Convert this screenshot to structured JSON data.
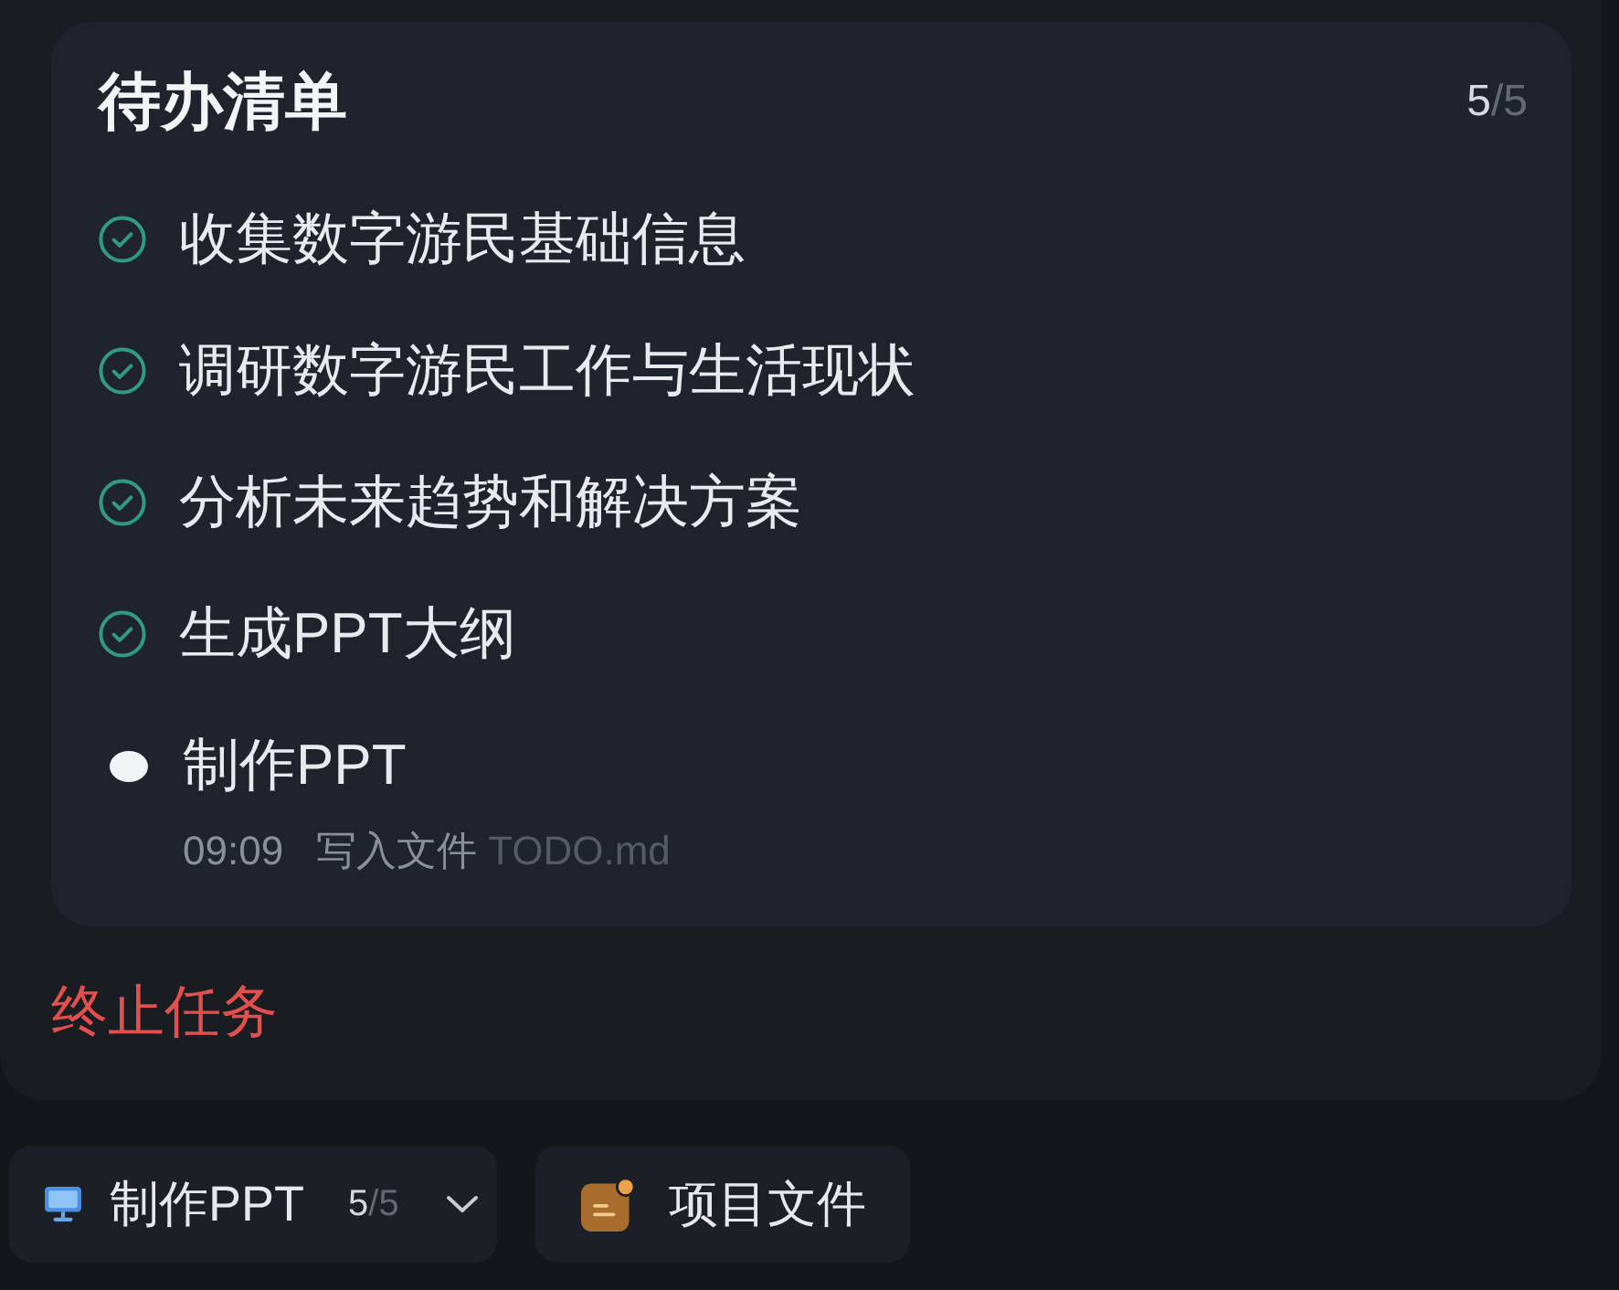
{
  "todo": {
    "title": "待办清单",
    "progress": {
      "done": "5",
      "total": "/5"
    },
    "items": [
      {
        "text": "收集数字游民基础信息",
        "done": true
      },
      {
        "text": "调研数字游民工作与生活现状",
        "done": true
      },
      {
        "text": "分析未来趋势和解决方案",
        "done": true
      },
      {
        "text": "生成PPT大纲",
        "done": true
      },
      {
        "text": "制作PPT",
        "done": false,
        "detail": {
          "time": "09:09",
          "action": "写入文件",
          "file": "TODO.md"
        }
      }
    ]
  },
  "stop_link": "终止任务",
  "bottom_bar": {
    "task_button": {
      "label": "制作PPT",
      "done": "5",
      "total": "/5"
    },
    "files_button": {
      "label": "项目文件"
    }
  }
}
